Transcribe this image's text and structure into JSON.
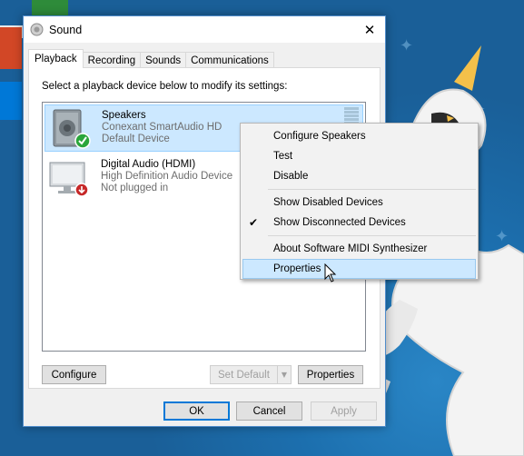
{
  "window": {
    "title": "Sound",
    "close_glyph": "✕"
  },
  "tabs": [
    {
      "label": "Playback",
      "active": true
    },
    {
      "label": "Recording",
      "active": false
    },
    {
      "label": "Sounds",
      "active": false
    },
    {
      "label": "Communications",
      "active": false
    }
  ],
  "playback": {
    "instruction": "Select a playback device below to modify its settings:",
    "devices": [
      {
        "name": "Speakers",
        "driver": "Conexant SmartAudio HD",
        "status": "Default Device",
        "icon": "speaker-icon",
        "status_icon": "green-check-icon",
        "selected": true
      },
      {
        "name": "Digital Audio (HDMI)",
        "driver": "High Definition Audio Device",
        "status": "Not plugged in",
        "icon": "monitor-icon",
        "status_icon": "red-down-arrow-icon",
        "selected": false
      }
    ],
    "configure_label": "Configure",
    "set_default_label": "Set Default",
    "properties_label": "Properties"
  },
  "footer": {
    "ok_label": "OK",
    "cancel_label": "Cancel",
    "apply_label": "Apply"
  },
  "context_menu": {
    "items": [
      {
        "label": "Configure Speakers"
      },
      {
        "label": "Test"
      },
      {
        "label": "Disable"
      },
      {
        "label": "Show Disabled Devices"
      },
      {
        "label": "Show Disconnected Devices",
        "checked": true
      },
      {
        "label": "About Software MIDI Synthesizer"
      },
      {
        "label": "Properties",
        "hovered": true
      }
    ],
    "check_glyph": "✔"
  },
  "colors": {
    "selection": "#cce8ff",
    "accent": "#0078d7",
    "desktop": "#1d74b4"
  }
}
